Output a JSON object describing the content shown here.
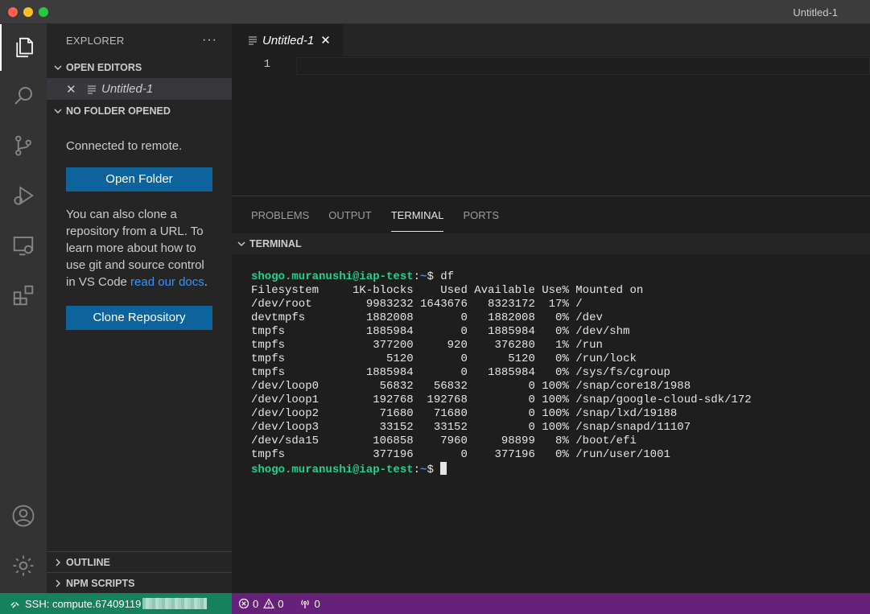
{
  "window": {
    "title": "Untitled-1"
  },
  "sidebar": {
    "title": "EXPLORER",
    "more_label": "···",
    "open_editors": {
      "label": "OPEN EDITORS",
      "items": [
        {
          "close": "✕",
          "name": "Untitled-1"
        }
      ]
    },
    "no_folder": {
      "label": "NO FOLDER OPENED",
      "connected_text": "Connected to remote.",
      "open_folder_label": "Open Folder",
      "clone_text": "You can also clone a repository from a URL. To learn more about how to use git and source control in VS Code ",
      "docs_link": "read our docs",
      "clone_text_end": ".",
      "clone_button_label": "Clone Repository"
    },
    "outline_label": "OUTLINE",
    "npm_scripts_label": "NPM SCRIPTS"
  },
  "editor": {
    "tab": {
      "name": "Untitled-1",
      "close": "✕"
    },
    "line_number": "1"
  },
  "panel": {
    "tabs": [
      "PROBLEMS",
      "OUTPUT",
      "TERMINAL",
      "PORTS"
    ],
    "active_tab": "TERMINAL",
    "section_label": "TERMINAL",
    "terminal": {
      "prompt_user": "shogo.muranushi@iap-test",
      "prompt_path": "~",
      "prompt_symbol": "$ ",
      "command": "df",
      "output": [
        "Filesystem     1K-blocks    Used Available Use% Mounted on",
        "/dev/root        9983232 1643676   8323172  17% /",
        "devtmpfs         1882008       0   1882008   0% /dev",
        "tmpfs            1885984       0   1885984   0% /dev/shm",
        "tmpfs             377200     920    376280   1% /run",
        "tmpfs               5120       0      5120   0% /run/lock",
        "tmpfs            1885984       0   1885984   0% /sys/fs/cgroup",
        "/dev/loop0         56832   56832         0 100% /snap/core18/1988",
        "/dev/loop1        192768  192768         0 100% /snap/google-cloud-sdk/172",
        "/dev/loop2         71680   71680         0 100% /snap/lxd/19188",
        "/dev/loop3         33152   33152         0 100% /snap/snapd/11107",
        "/dev/sda15        106858    7960     98899   8% /boot/efi",
        "tmpfs             377196       0    377196   0% /run/user/1001"
      ]
    }
  },
  "statusbar": {
    "remote_label": "SSH: compute.67409119",
    "errors": "0",
    "warnings": "0",
    "ports": "0"
  },
  "colors": {
    "statusbar": "#68217a",
    "remote": "#16825d",
    "button": "#0e639c",
    "prompt_user": "#23d18b",
    "prompt_path": "#3b8eea"
  },
  "icons": [
    "files-icon",
    "search-icon",
    "source-control-icon",
    "run-debug-icon",
    "remote-explorer-icon",
    "extensions-icon",
    "account-icon",
    "settings-gear-icon"
  ]
}
